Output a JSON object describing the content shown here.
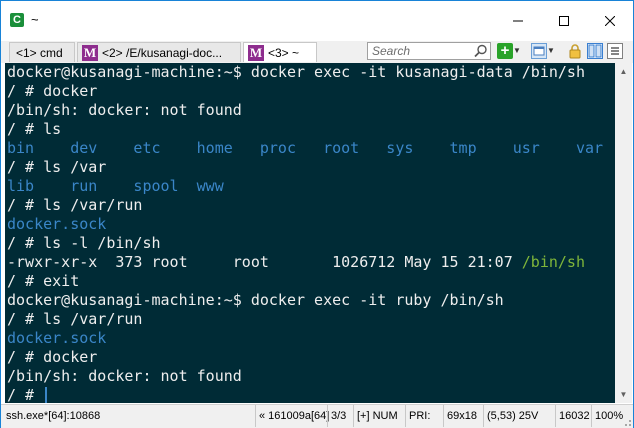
{
  "window": {
    "title": "~",
    "app_icon_glyph": "C"
  },
  "tabs": [
    {
      "label": "<1> cmd",
      "active": false
    },
    {
      "label": "<2> /E/kusanagi-doc...",
      "badge": "M",
      "active": false
    },
    {
      "label": "<3> ~",
      "badge": "M",
      "active": true
    }
  ],
  "search": {
    "placeholder": "Search"
  },
  "terminal": {
    "lines": [
      [
        {
          "t": "docker@kusanagi-machine:~$ docker exec -it kusanagi-data /bin/sh",
          "c": ""
        }
      ],
      [
        {
          "t": "/ # docker",
          "c": ""
        }
      ],
      [
        {
          "t": "/bin/sh: docker: not found",
          "c": ""
        }
      ],
      [
        {
          "t": "/ # ls",
          "c": ""
        }
      ],
      [
        {
          "t": "bin    dev    etc    home   proc   root   sys    tmp    usr    var",
          "c": "blue"
        }
      ],
      [
        {
          "t": "/ # ls /var",
          "c": ""
        }
      ],
      [
        {
          "t": "lib    run    spool  www",
          "c": "blue"
        }
      ],
      [
        {
          "t": "/ # ls /var/run",
          "c": ""
        }
      ],
      [
        {
          "t": "docker.sock",
          "c": "blue"
        }
      ],
      [
        {
          "t": "/ # ls -l /bin/sh",
          "c": ""
        }
      ],
      [
        {
          "t": "-rwxr-xr-x  373 root     root       1026712 May 15 21:07 ",
          "c": ""
        },
        {
          "t": "/bin/sh",
          "c": "green"
        }
      ],
      [
        {
          "t": "/ # exit",
          "c": ""
        }
      ],
      [
        {
          "t": "docker@kusanagi-machine:~$ docker exec -it ruby /bin/sh",
          "c": ""
        }
      ],
      [
        {
          "t": "/ # ls /var/run",
          "c": ""
        }
      ],
      [
        {
          "t": "docker.sock",
          "c": "blue"
        }
      ],
      [
        {
          "t": "/ # docker",
          "c": ""
        }
      ],
      [
        {
          "t": "/bin/sh: docker: not found",
          "c": ""
        }
      ],
      [
        {
          "t": "/ # ",
          "c": ""
        }
      ]
    ],
    "colors": {
      "background": "#002b36",
      "text": "#eeeeee",
      "blue": "#3a86c8",
      "green": "#7fb63a"
    }
  },
  "statusbar": {
    "process": "ssh.exe*[64]:10868",
    "build": "« 161009a[64]",
    "pages": "3/3",
    "mode": "[+] NUM",
    "priority": "PRI:",
    "size": "69x18",
    "cursor_pos": "(5,53) 25V",
    "buffer": "16032",
    "zoom": "100%"
  }
}
